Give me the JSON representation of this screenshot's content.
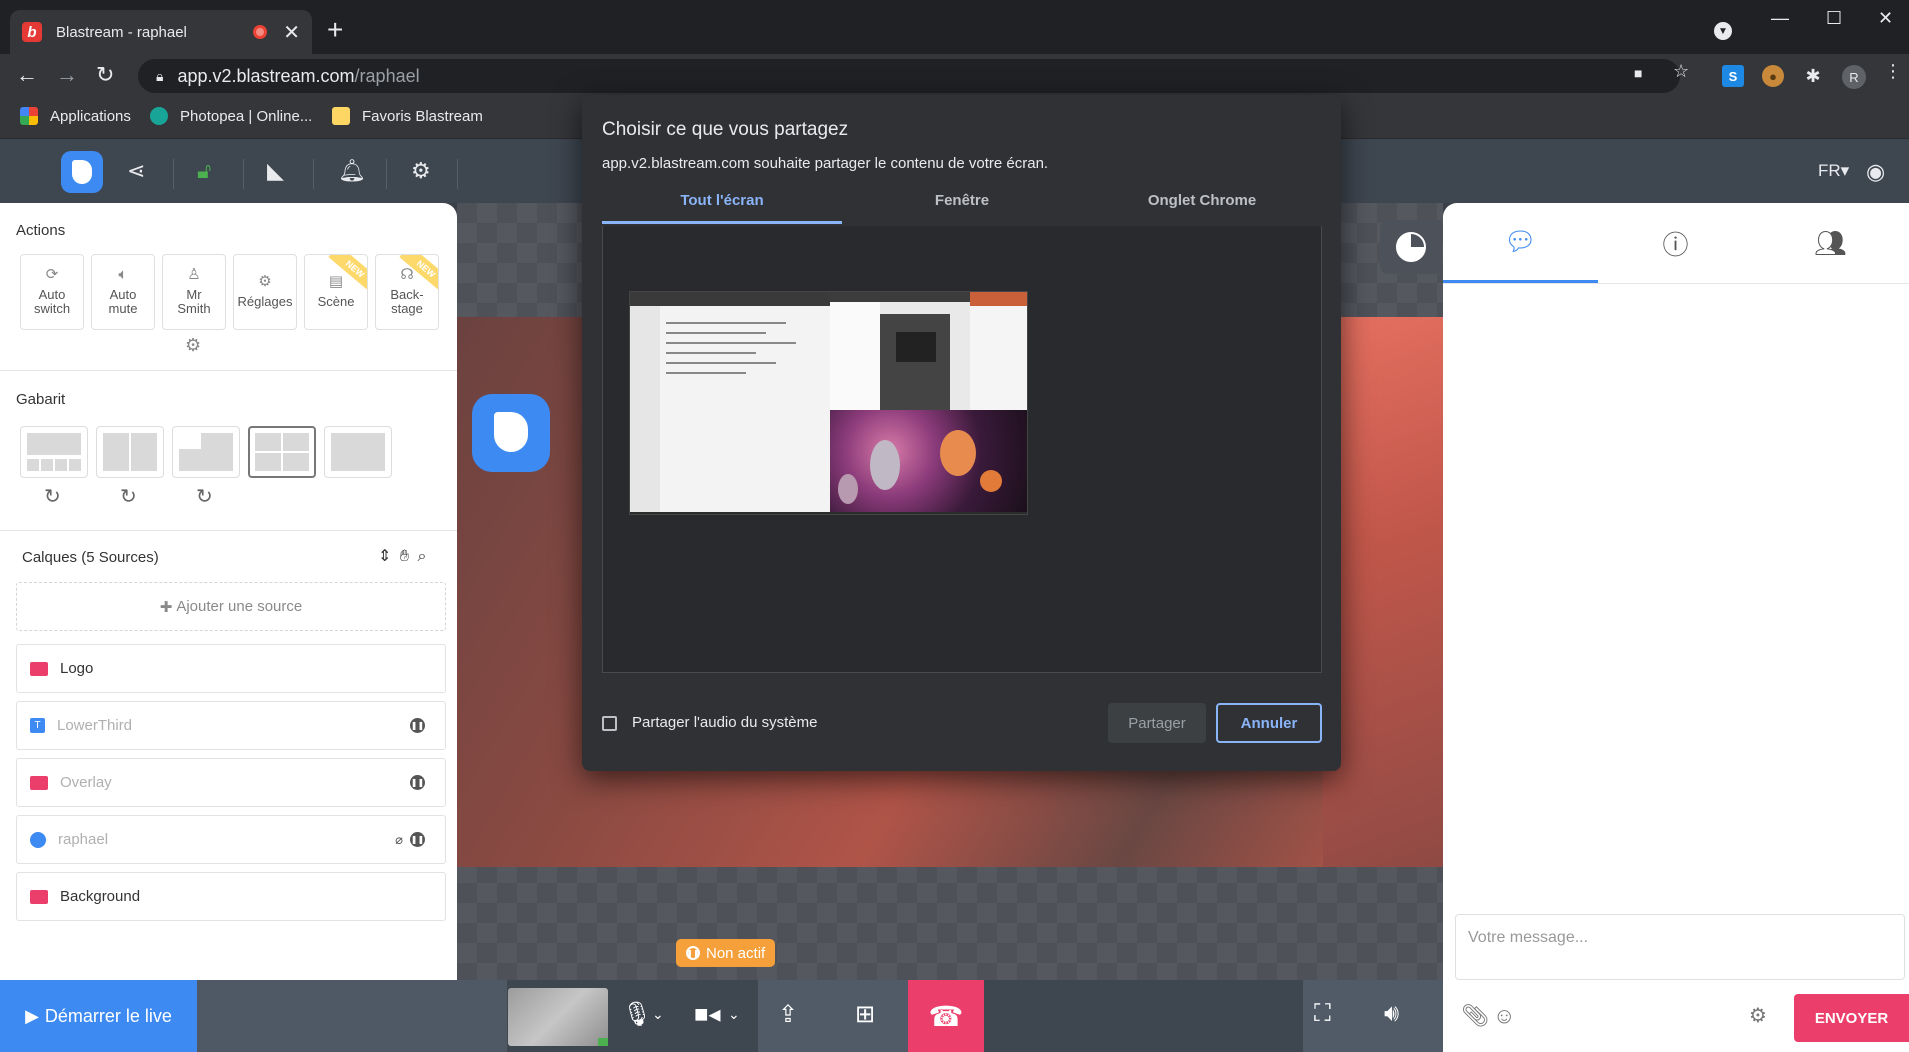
{
  "browser": {
    "tab_title": "Blastream - raphael",
    "favicon_letter": "b",
    "url_host": "app.v2.blastream.com",
    "url_path": "/raphael",
    "profile_initial": "R",
    "bookmarks": [
      {
        "label": "Applications"
      },
      {
        "label": "Photopea | Online..."
      },
      {
        "label": "Favoris Blastream"
      }
    ]
  },
  "app": {
    "lang": "FR",
    "actions_title": "Actions",
    "actions": [
      {
        "label": "Auto\nswitch",
        "icon": "refresh-icon"
      },
      {
        "label": "Auto\nmute",
        "icon": "speaker-mute-icon"
      },
      {
        "label": "Mr\nSmith",
        "icon": "person-icon"
      },
      {
        "label": "Réglages",
        "icon": "gears-icon"
      },
      {
        "label": "Scène",
        "icon": "clapper-icon",
        "badge": "NEW"
      },
      {
        "label": "Back-\nstage",
        "icon": "headset-icon",
        "badge": "NEW"
      }
    ],
    "layout_title": "Gabarit",
    "layers_title": "Calques (5 Sources)",
    "add_source": "Ajouter une source",
    "layers": [
      {
        "name": "Logo",
        "active": true
      },
      {
        "name": "LowerThird",
        "active": false
      },
      {
        "name": "Overlay",
        "active": false
      },
      {
        "name": "raphael",
        "active": false
      },
      {
        "name": "Background",
        "active": true
      }
    ],
    "status_badge": "Non actif",
    "live_button": "Démarrer le live",
    "message_placeholder": "Votre message...",
    "send_button": "ENVOYER"
  },
  "dialog": {
    "title": "Choisir ce que vous partagez",
    "subtitle": "app.v2.blastream.com souhaite partager le contenu de votre écran.",
    "tabs": [
      "Tout l'écran",
      "Fenêtre",
      "Onglet Chrome"
    ],
    "active_tab": 0,
    "audio_label": "Partager l'audio du système",
    "share_button": "Partager",
    "cancel_button": "Annuler"
  },
  "colors": {
    "brand_blue": "#3d8bf2",
    "accent_pink": "#ec3e6a",
    "status_orange": "#f5a03a",
    "dialog_link": "#8ab4f8"
  }
}
